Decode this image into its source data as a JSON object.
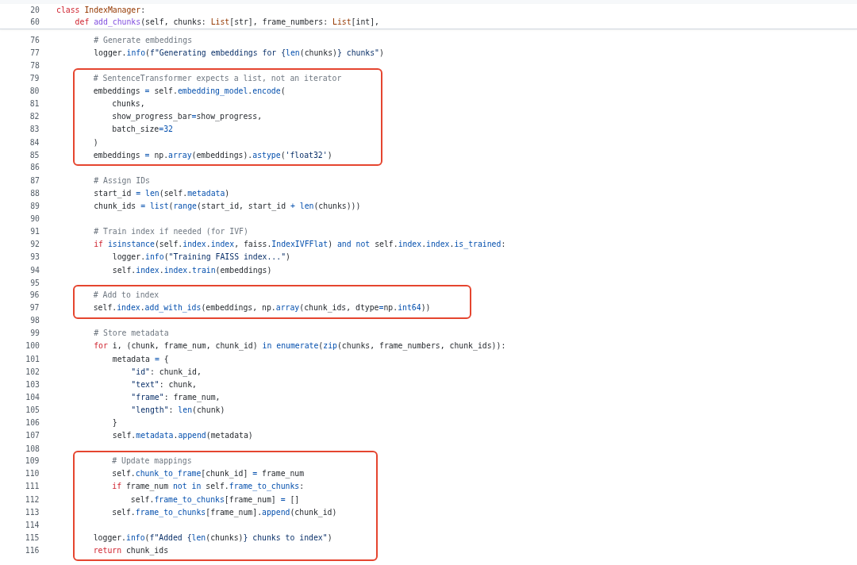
{
  "sticky_header": [
    {
      "number": "20",
      "tokens": [
        {
          "kind": "keyword",
          "text": "class "
        },
        {
          "kind": "class",
          "text": "IndexManager"
        },
        {
          "kind": "plain",
          "text": ":"
        }
      ]
    },
    {
      "number": "60",
      "tokens": [
        {
          "kind": "keyword",
          "text": "    def "
        },
        {
          "kind": "function",
          "text": "add_chunks"
        },
        {
          "kind": "plain",
          "text": "(self, chunks: "
        },
        {
          "kind": "class",
          "text": "List"
        },
        {
          "kind": "plain",
          "text": "[str], frame_numbers: "
        },
        {
          "kind": "class",
          "text": "List"
        },
        {
          "kind": "plain",
          "text": "[int],"
        }
      ]
    }
  ],
  "blocks": [
    {
      "boxed": false,
      "lines": [
        {
          "number": "76",
          "tokens": [
            {
              "kind": "comment",
              "text": "        # Generate embeddings"
            }
          ]
        },
        {
          "number": "77",
          "tokens": [
            {
              "kind": "plain",
              "text": "        logger."
            },
            {
              "kind": "name",
              "text": "info"
            },
            {
              "kind": "plain",
              "text": "("
            },
            {
              "kind": "string",
              "text": "f\"Generating embeddings for {"
            },
            {
              "kind": "name",
              "text": "len"
            },
            {
              "kind": "plain",
              "text": "(chunks)"
            },
            {
              "kind": "string",
              "text": "} chunks\""
            },
            {
              "kind": "plain",
              "text": ")"
            }
          ]
        },
        {
          "number": "78"
        }
      ]
    },
    {
      "boxed": true,
      "lines": [
        {
          "number": "79",
          "tokens": [
            {
              "kind": "comment",
              "text": "        # SentenceTransformer expects a list, not an iterator"
            }
          ]
        },
        {
          "number": "80",
          "tokens": [
            {
              "kind": "plain",
              "text": "        embeddings "
            },
            {
              "kind": "name",
              "text": "="
            },
            {
              "kind": "plain",
              "text": " self."
            },
            {
              "kind": "name",
              "text": "embedding_model"
            },
            {
              "kind": "plain",
              "text": "."
            },
            {
              "kind": "name",
              "text": "encode"
            },
            {
              "kind": "plain",
              "text": "("
            }
          ]
        },
        {
          "number": "81",
          "tokens": [
            {
              "kind": "plain",
              "text": "            chunks,"
            }
          ]
        },
        {
          "number": "82",
          "tokens": [
            {
              "kind": "plain",
              "text": "            show_progress_bar"
            },
            {
              "kind": "name",
              "text": "="
            },
            {
              "kind": "plain",
              "text": "show_progress,"
            }
          ]
        },
        {
          "number": "83",
          "tokens": [
            {
              "kind": "plain",
              "text": "            batch_size"
            },
            {
              "kind": "name",
              "text": "=32"
            }
          ]
        },
        {
          "number": "84",
          "tokens": [
            {
              "kind": "plain",
              "text": "        )"
            }
          ]
        },
        {
          "number": "85",
          "tokens": [
            {
              "kind": "plain",
              "text": "        embeddings "
            },
            {
              "kind": "name",
              "text": "="
            },
            {
              "kind": "plain",
              "text": " np."
            },
            {
              "kind": "name",
              "text": "array"
            },
            {
              "kind": "plain",
              "text": "(embeddings)."
            },
            {
              "kind": "name",
              "text": "astype"
            },
            {
              "kind": "plain",
              "text": "("
            },
            {
              "kind": "string",
              "text": "'float32'"
            },
            {
              "kind": "plain",
              "text": ")"
            }
          ]
        }
      ]
    },
    {
      "boxed": false,
      "lines": [
        {
          "number": "86"
        },
        {
          "number": "87",
          "tokens": [
            {
              "kind": "comment",
              "text": "        # Assign IDs"
            }
          ]
        },
        {
          "number": "88",
          "tokens": [
            {
              "kind": "plain",
              "text": "        start_id "
            },
            {
              "kind": "name",
              "text": "= len"
            },
            {
              "kind": "plain",
              "text": "(self."
            },
            {
              "kind": "name",
              "text": "metadata"
            },
            {
              "kind": "plain",
              "text": ")"
            }
          ]
        },
        {
          "number": "89",
          "tokens": [
            {
              "kind": "plain",
              "text": "        chunk_ids "
            },
            {
              "kind": "name",
              "text": "= list"
            },
            {
              "kind": "plain",
              "text": "("
            },
            {
              "kind": "name",
              "text": "range"
            },
            {
              "kind": "plain",
              "text": "(start_id, start_id "
            },
            {
              "kind": "name",
              "text": "+ len"
            },
            {
              "kind": "plain",
              "text": "(chunks)))"
            }
          ]
        },
        {
          "number": "90"
        },
        {
          "number": "91",
          "tokens": [
            {
              "kind": "comment",
              "text": "        # Train index if needed (for IVF)"
            }
          ]
        },
        {
          "number": "92",
          "tokens": [
            {
              "kind": "keyword",
              "text": "        if "
            },
            {
              "kind": "name",
              "text": "isinstance"
            },
            {
              "kind": "plain",
              "text": "(self."
            },
            {
              "kind": "name",
              "text": "index"
            },
            {
              "kind": "plain",
              "text": "."
            },
            {
              "kind": "name",
              "text": "index"
            },
            {
              "kind": "plain",
              "text": ", faiss."
            },
            {
              "kind": "name",
              "text": "IndexIVFFlat"
            },
            {
              "kind": "plain",
              "text": ") "
            },
            {
              "kind": "name",
              "text": "and not"
            },
            {
              "kind": "plain",
              "text": " self."
            },
            {
              "kind": "name",
              "text": "index"
            },
            {
              "kind": "plain",
              "text": "."
            },
            {
              "kind": "name",
              "text": "index"
            },
            {
              "kind": "plain",
              "text": "."
            },
            {
              "kind": "name",
              "text": "is_trained"
            },
            {
              "kind": "plain",
              "text": ":"
            }
          ]
        },
        {
          "number": "93",
          "tokens": [
            {
              "kind": "plain",
              "text": "            logger."
            },
            {
              "kind": "name",
              "text": "info"
            },
            {
              "kind": "plain",
              "text": "("
            },
            {
              "kind": "string",
              "text": "\"Training FAISS index...\""
            },
            {
              "kind": "plain",
              "text": ")"
            }
          ]
        },
        {
          "number": "94",
          "tokens": [
            {
              "kind": "plain",
              "text": "            self."
            },
            {
              "kind": "name",
              "text": "index"
            },
            {
              "kind": "plain",
              "text": "."
            },
            {
              "kind": "name",
              "text": "index"
            },
            {
              "kind": "plain",
              "text": "."
            },
            {
              "kind": "name",
              "text": "train"
            },
            {
              "kind": "plain",
              "text": "(embeddings)"
            }
          ]
        },
        {
          "number": "95"
        }
      ]
    },
    {
      "boxed": true,
      "lines": [
        {
          "number": "96",
          "tokens": [
            {
              "kind": "comment",
              "text": "        # Add to index"
            }
          ]
        },
        {
          "number": "97",
          "tokens": [
            {
              "kind": "plain",
              "text": "        self."
            },
            {
              "kind": "name",
              "text": "index"
            },
            {
              "kind": "plain",
              "text": "."
            },
            {
              "kind": "name",
              "text": "add_with_ids"
            },
            {
              "kind": "plain",
              "text": "(embeddings, np."
            },
            {
              "kind": "name",
              "text": "array"
            },
            {
              "kind": "plain",
              "text": "(chunk_ids, dtype"
            },
            {
              "kind": "name",
              "text": "="
            },
            {
              "kind": "plain",
              "text": "np."
            },
            {
              "kind": "name",
              "text": "int64"
            },
            {
              "kind": "plain",
              "text": "))"
            }
          ]
        }
      ]
    },
    {
      "boxed": false,
      "lines": [
        {
          "number": "98"
        },
        {
          "number": "99",
          "tokens": [
            {
              "kind": "comment",
              "text": "        # Store metadata"
            }
          ]
        },
        {
          "number": "100",
          "tokens": [
            {
              "kind": "keyword",
              "text": "        for"
            },
            {
              "kind": "plain",
              "text": " i, (chunk, frame_num, chunk_id) "
            },
            {
              "kind": "name",
              "text": "in enumerate"
            },
            {
              "kind": "plain",
              "text": "("
            },
            {
              "kind": "name",
              "text": "zip"
            },
            {
              "kind": "plain",
              "text": "(chunks, frame_numbers, chunk_ids)):"
            }
          ]
        },
        {
          "number": "101",
          "tokens": [
            {
              "kind": "plain",
              "text": "            metadata "
            },
            {
              "kind": "name",
              "text": "="
            },
            {
              "kind": "plain",
              "text": " {"
            }
          ]
        },
        {
          "number": "102",
          "tokens": [
            {
              "kind": "string",
              "text": "                \"id\""
            },
            {
              "kind": "plain",
              "text": ": chunk_id,"
            }
          ]
        },
        {
          "number": "103",
          "tokens": [
            {
              "kind": "string",
              "text": "                \"text\""
            },
            {
              "kind": "plain",
              "text": ": chunk,"
            }
          ]
        },
        {
          "number": "104",
          "tokens": [
            {
              "kind": "string",
              "text": "                \"frame\""
            },
            {
              "kind": "plain",
              "text": ": frame_num,"
            }
          ]
        },
        {
          "number": "105",
          "tokens": [
            {
              "kind": "string",
              "text": "                \"length\""
            },
            {
              "kind": "plain",
              "text": ": "
            },
            {
              "kind": "name",
              "text": "len"
            },
            {
              "kind": "plain",
              "text": "(chunk)"
            }
          ]
        },
        {
          "number": "106",
          "tokens": [
            {
              "kind": "plain",
              "text": "            }"
            }
          ]
        },
        {
          "number": "107",
          "tokens": [
            {
              "kind": "plain",
              "text": "            self."
            },
            {
              "kind": "name",
              "text": "metadata"
            },
            {
              "kind": "plain",
              "text": "."
            },
            {
              "kind": "name",
              "text": "append"
            },
            {
              "kind": "plain",
              "text": "(metadata)"
            }
          ]
        },
        {
          "number": "108"
        }
      ]
    },
    {
      "boxed": true,
      "lines": [
        {
          "number": "109",
          "tokens": [
            {
              "kind": "comment",
              "text": "            # Update mappings"
            }
          ]
        },
        {
          "number": "110",
          "tokens": [
            {
              "kind": "plain",
              "text": "            self."
            },
            {
              "kind": "name",
              "text": "chunk_to_frame"
            },
            {
              "kind": "plain",
              "text": "[chunk_id] "
            },
            {
              "kind": "name",
              "text": "="
            },
            {
              "kind": "plain",
              "text": " frame_num"
            }
          ]
        },
        {
          "number": "111",
          "tokens": [
            {
              "kind": "keyword",
              "text": "            if"
            },
            {
              "kind": "plain",
              "text": " frame_num "
            },
            {
              "kind": "name",
              "text": "not in"
            },
            {
              "kind": "plain",
              "text": " self."
            },
            {
              "kind": "name",
              "text": "frame_to_chunks"
            },
            {
              "kind": "plain",
              "text": ":"
            }
          ]
        },
        {
          "number": "112",
          "tokens": [
            {
              "kind": "plain",
              "text": "                self."
            },
            {
              "kind": "name",
              "text": "frame_to_chunks"
            },
            {
              "kind": "plain",
              "text": "[frame_num] "
            },
            {
              "kind": "name",
              "text": "="
            },
            {
              "kind": "plain",
              "text": " []"
            }
          ]
        },
        {
          "number": "113",
          "tokens": [
            {
              "kind": "plain",
              "text": "            self."
            },
            {
              "kind": "name",
              "text": "frame_to_chunks"
            },
            {
              "kind": "plain",
              "text": "[frame_num]."
            },
            {
              "kind": "name",
              "text": "append"
            },
            {
              "kind": "plain",
              "text": "(chunk_id)"
            }
          ]
        },
        {
          "number": "114"
        },
        {
          "number": "115",
          "tokens": [
            {
              "kind": "plain",
              "text": "        logger."
            },
            {
              "kind": "name",
              "text": "info"
            },
            {
              "kind": "plain",
              "text": "("
            },
            {
              "kind": "string",
              "text": "f\"Added {"
            },
            {
              "kind": "name",
              "text": "len"
            },
            {
              "kind": "plain",
              "text": "(chunks)"
            },
            {
              "kind": "string",
              "text": "} chunks to index\""
            },
            {
              "kind": "plain",
              "text": ")"
            }
          ]
        },
        {
          "number": "116",
          "tokens": [
            {
              "kind": "keyword",
              "text": "        return"
            },
            {
              "kind": "plain",
              "text": " chunk_ids"
            }
          ]
        }
      ]
    }
  ]
}
